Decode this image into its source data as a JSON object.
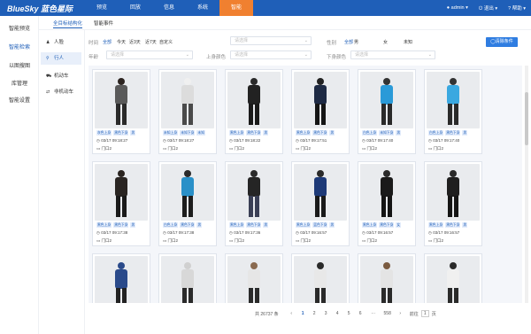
{
  "app": {
    "logo": "BlueSky 蓝色星际"
  },
  "nav": {
    "items": [
      "预览",
      "回放",
      "信息",
      "系统",
      "智能"
    ],
    "active": 4
  },
  "top_right": {
    "user": "admin ▾",
    "exit": "退出 ▾",
    "help": "帮助 ▾"
  },
  "sidebar": {
    "items": [
      "智能预览",
      "智能检索",
      "以图搜图",
      "库管理",
      "智能设置"
    ],
    "active": 1
  },
  "subtabs": {
    "items": [
      "全目标结构化",
      "智能事件"
    ],
    "active": 0
  },
  "left_panel": {
    "items": [
      {
        "icon": "person-icon",
        "glyph": "♟",
        "label": "人脸"
      },
      {
        "icon": "walk-icon",
        "glyph": "⚲",
        "label": "行人"
      },
      {
        "icon": "car-icon",
        "glyph": "⛟",
        "label": "机动车"
      },
      {
        "icon": "bike-icon",
        "glyph": "⇄",
        "label": "非机动车"
      }
    ],
    "active": 1
  },
  "filters": {
    "time_label": "时间",
    "time_options": [
      "全部",
      "今天",
      "近3天",
      "近7天",
      "自定义"
    ],
    "time_active": 0,
    "channel_label": "通道",
    "channel_placeholder": "请选择",
    "gender_label": "性别",
    "gender_options": [
      "全部",
      "男",
      "女",
      "未知"
    ],
    "gender_active": 0,
    "age_label": "年龄",
    "age_placeholder": "请选择",
    "upper_label": "上身颜色",
    "upper_placeholder": "请选择",
    "lower_label": "下身颜色",
    "lower_placeholder": "请选择",
    "clear_button": "◯清除条件"
  },
  "cards": [
    {
      "tags": [
        "灰色上身",
        "黑色下身",
        "男"
      ],
      "time": "03/17 09:18:27",
      "loc": "门口2",
      "top": "#5a5a5a",
      "bottom": "#2a2a2a",
      "head": "#2c2420"
    },
    {
      "tags": [
        "未知上身",
        "未知下身",
        "未知"
      ],
      "time": "03/17 09:18:27",
      "loc": "门口2",
      "top": "#dcdcdc",
      "bottom": "#4a4a4a",
      "head": "#f0f0f0"
    },
    {
      "tags": [
        "黑色上身",
        "黑色下身",
        "男"
      ],
      "time": "03/17 09:18:22",
      "loc": "门口2",
      "top": "#222222",
      "bottom": "#1a1a1a",
      "head": "#2a2a2a"
    },
    {
      "tags": [
        "黑色上身",
        "黑色下身",
        "男"
      ],
      "time": "03/17 09:17:51",
      "loc": "门口2",
      "top": "#1e2a44",
      "bottom": "#151515",
      "head": "#222222"
    },
    {
      "tags": [
        "白色上身",
        "未知下身",
        "男"
      ],
      "time": "03/17 09:17:40",
      "loc": "门口2",
      "top": "#2a9ad8",
      "bottom": "#2a2a2a",
      "head": "#333333"
    },
    {
      "tags": [
        "白色上身",
        "黑色下身",
        "男"
      ],
      "time": "03/17 09:17:40",
      "loc": "门口2",
      "top": "#3aa8e0",
      "bottom": "#2a2a2a",
      "head": "#333333"
    },
    {
      "tags": [
        "黑色上身",
        "黑色下身",
        "男"
      ],
      "time": "03/17 09:17:38",
      "loc": "门口2",
      "top": "#2a2522",
      "bottom": "#1a1a1a",
      "head": "#2a2420"
    },
    {
      "tags": [
        "白色上身",
        "黑色下身",
        "男"
      ],
      "time": "03/17 09:17:38",
      "loc": "门口2",
      "top": "#2a90c8",
      "bottom": "#1d1d1d",
      "head": "#2a2a2a"
    },
    {
      "tags": [
        "黑色上身",
        "黑色下身",
        "男"
      ],
      "time": "03/17 09:17:36",
      "loc": "门口2",
      "top": "#252525",
      "bottom": "#3a3f55",
      "head": "#2a2a2a"
    },
    {
      "tags": [
        "黑色上身",
        "蓝色下身",
        "男"
      ],
      "time": "03/17 09:16:57",
      "loc": "门口2",
      "top": "#1e3a78",
      "bottom": "#1a1a1a",
      "head": "#2a2a2a"
    },
    {
      "tags": [
        "黑色上身",
        "黑色下身",
        "女"
      ],
      "time": "03/17 09:16:57",
      "loc": "门口2",
      "top": "#1a1a1a",
      "bottom": "#151515",
      "head": "#2a2a2a"
    },
    {
      "tags": [
        "黑色上身",
        "黑色下身",
        "男"
      ],
      "time": "03/17 09:16:57",
      "loc": "门口2",
      "top": "#1f1f1f",
      "bottom": "#151515",
      "head": "#2a2a2a"
    },
    {
      "tags": [],
      "time": "",
      "loc": "",
      "top": "#2a4a8a",
      "bottom": "#222222",
      "head": "#2a4a8a"
    },
    {
      "tags": [],
      "time": "",
      "loc": "",
      "top": "#d8d8d8",
      "bottom": "#2a2a2a",
      "head": "#d0d0d0"
    },
    {
      "tags": [],
      "time": "",
      "loc": "",
      "top": "#e6e6e6",
      "bottom": "#2a2a2a",
      "head": "#8a6a50"
    },
    {
      "tags": [],
      "time": "",
      "loc": "",
      "top": "#e8e8e8",
      "bottom": "#2a2a2a",
      "head": "#2a2a2a"
    },
    {
      "tags": [],
      "time": "",
      "loc": "",
      "top": "#e4e4e4",
      "bottom": "#2a2a2a",
      "head": "#7a5a40"
    },
    {
      "tags": [],
      "time": "",
      "loc": "",
      "top": "#f0f0f0",
      "bottom": "#2a2a2a",
      "head": "#2a2a2a"
    }
  ],
  "pagination": {
    "total": "共 26737 条",
    "prev": "‹",
    "pages": [
      "1",
      "2",
      "3",
      "4",
      "5",
      "6",
      "···",
      "558"
    ],
    "active": 0,
    "next": "›",
    "goto": "前往",
    "goto_value": "1",
    "page_unit": "页"
  }
}
